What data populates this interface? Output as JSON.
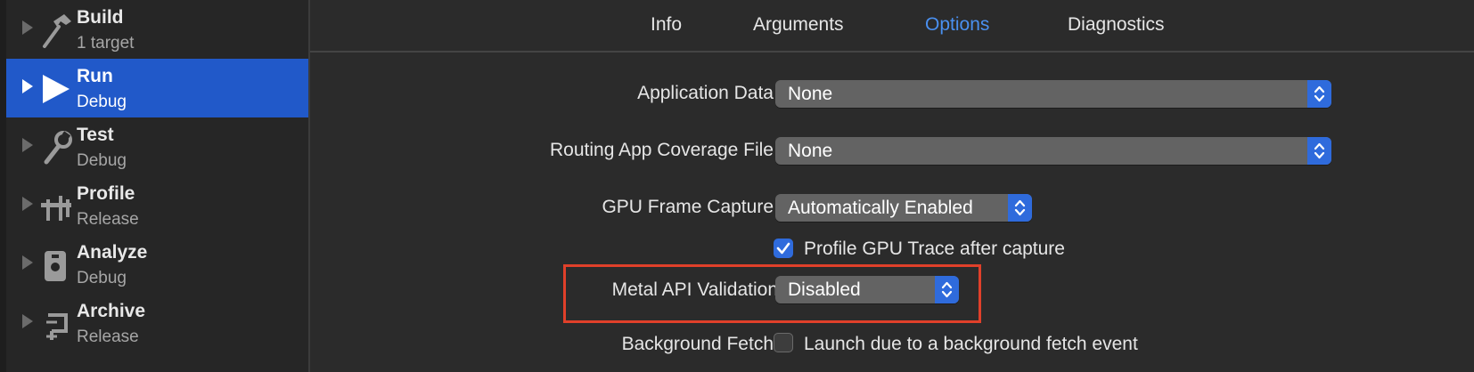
{
  "sidebar": {
    "actions": [
      {
        "title": "Build",
        "subtitle": "1 target",
        "icon": "hammer-icon",
        "selected": false
      },
      {
        "title": "Run",
        "subtitle": "Debug",
        "icon": "play-icon",
        "selected": true
      },
      {
        "title": "Test",
        "subtitle": "Debug",
        "icon": "wrench-icon",
        "selected": false
      },
      {
        "title": "Profile",
        "subtitle": "Release",
        "icon": "gauge-icon",
        "selected": false
      },
      {
        "title": "Analyze",
        "subtitle": "Debug",
        "icon": "analyze-icon",
        "selected": false
      },
      {
        "title": "Archive",
        "subtitle": "Release",
        "icon": "archive-icon",
        "selected": false
      }
    ]
  },
  "tabs": [
    {
      "label": "Info",
      "active": false
    },
    {
      "label": "Arguments",
      "active": false
    },
    {
      "label": "Options",
      "active": true
    },
    {
      "label": "Diagnostics",
      "active": false
    }
  ],
  "options": {
    "application_data": {
      "label": "Application Data",
      "value": "None"
    },
    "routing_coverage": {
      "label": "Routing App Coverage File",
      "value": "None"
    },
    "gpu_frame_capture": {
      "label": "GPU Frame Capture",
      "value": "Automatically Enabled"
    },
    "profile_gpu_trace": {
      "label": "Profile GPU Trace after capture",
      "checked": true
    },
    "metal_api_validation": {
      "label": "Metal API Validation",
      "value": "Disabled"
    },
    "background_fetch": {
      "label": "Background Fetch",
      "checkbox_label": "Launch due to a background fetch event",
      "checked": false
    }
  },
  "colors": {
    "accent": "#2f6bdc",
    "selection": "#2159c9",
    "active_tab": "#4a90f0",
    "highlight_border": "#e0402a"
  }
}
